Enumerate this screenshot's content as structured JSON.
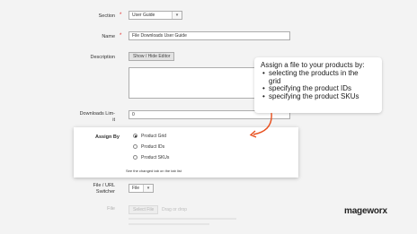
{
  "form": {
    "section": {
      "label": "Section",
      "value": "User Guide"
    },
    "name": {
      "label": "Name",
      "value": "File Downloads User Guide"
    },
    "description": {
      "label": "Description",
      "toggle_button": "Show / Hide Editor"
    },
    "downloads_limit": {
      "label_line1": "Downloads Lim-",
      "label_line2": "it",
      "value": "0"
    },
    "assign_by": {
      "label": "Assign By",
      "options": [
        "Product Grid",
        "Product IDs",
        "Product SKUs"
      ],
      "selected": "Product Grid",
      "hint": "See the changed tab on the tab list"
    },
    "file_url_switcher": {
      "label_line1": "File / URL",
      "label_line2": "Switcher",
      "value": "File"
    },
    "file": {
      "label": "File",
      "browse_button": "Select File",
      "note": "Drag or drop"
    }
  },
  "callout": {
    "title": "Assign a file to your products by:",
    "items": [
      "selecting the products in the",
      "grid",
      "specifying the product IDs",
      "specifying the product SKUs"
    ],
    "accent_color": "#e8501e"
  },
  "brand": {
    "logo_text": "mageworx"
  }
}
